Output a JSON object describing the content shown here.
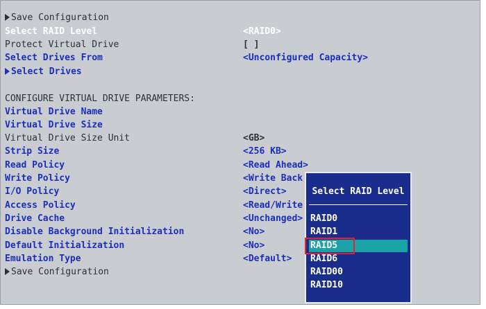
{
  "menu": {
    "top_item": "Save Configuration",
    "rows": [
      {
        "label": "Select RAID Level",
        "value": "<RAID0>"
      },
      {
        "label": "Protect Virtual Drive",
        "value": "[ ]"
      },
      {
        "label": "Select Drives From",
        "value": "<Unconfigured Capacity>"
      },
      {
        "label": "Select Drives",
        "value": ""
      }
    ],
    "section_heading": "CONFIGURE VIRTUAL DRIVE PARAMETERS:",
    "params": [
      {
        "label": "Virtual Drive Name",
        "value": ""
      },
      {
        "label": "Virtual Drive Size",
        "value": ""
      },
      {
        "label": "Virtual Drive Size Unit",
        "value": "<GB>"
      },
      {
        "label": "Strip Size",
        "value": "<256 KB>"
      },
      {
        "label": "Read Policy",
        "value": "<Read Ahead>"
      },
      {
        "label": "Write Policy",
        "value": "<Write Back"
      },
      {
        "label": "I/O Policy",
        "value": "<Direct>"
      },
      {
        "label": "Access Policy",
        "value": "<Read/Write"
      },
      {
        "label": "Drive Cache",
        "value": "<Unchanged>"
      },
      {
        "label": "Disable Background Initialization",
        "value": "<No>"
      },
      {
        "label": "Default Initialization",
        "value": "<No>"
      },
      {
        "label": "Emulation Type",
        "value": "<Default>"
      }
    ],
    "bottom_item": "Save Configuration"
  },
  "popup": {
    "title": "Select RAID Level",
    "options": [
      "RAID0",
      "RAID1",
      "RAID5",
      "RAID6",
      "RAID00",
      "RAID10"
    ],
    "selected": "RAID5"
  },
  "colors": {
    "background": "#c9ccd0",
    "link_blue": "#1b2fb8",
    "popup_bg": "#1a2c8c",
    "highlight": "#1aa3a6",
    "focus_border": "#e8222b"
  }
}
